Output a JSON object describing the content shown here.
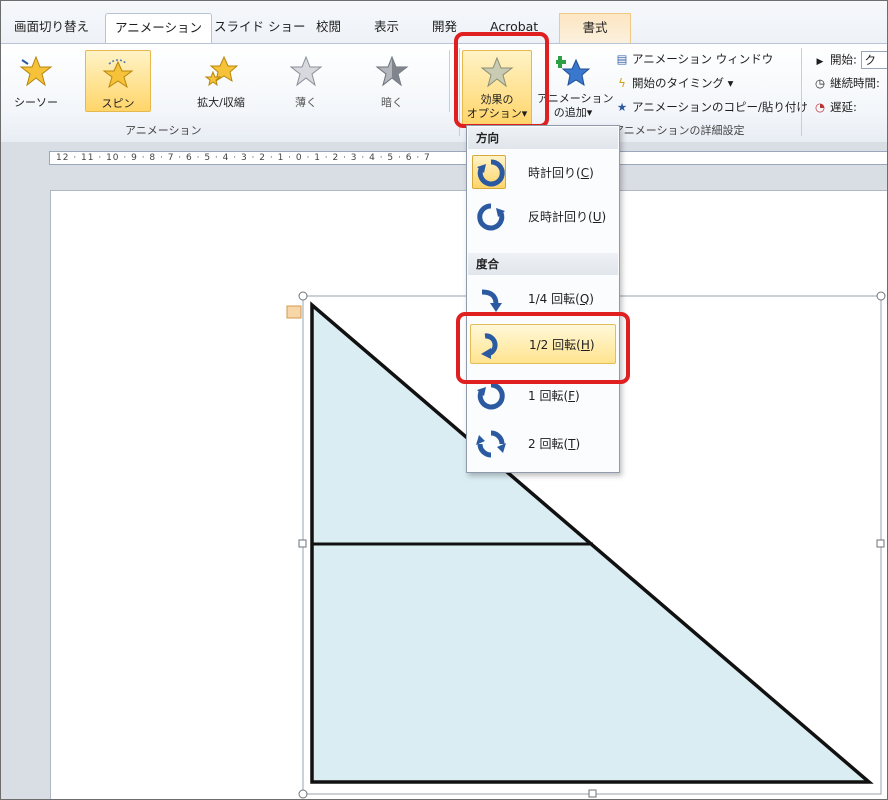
{
  "tabs": [
    {
      "label": "画面切り替え",
      "state": "normal"
    },
    {
      "label": "アニメーション",
      "state": "active"
    },
    {
      "label": "スライド ショー",
      "state": "normal"
    },
    {
      "label": "校閲",
      "state": "normal"
    },
    {
      "label": "表示",
      "state": "normal"
    },
    {
      "label": "開発",
      "state": "normal"
    },
    {
      "label": "Acrobat",
      "state": "normal"
    },
    {
      "label": "書式",
      "state": "contextual"
    }
  ],
  "animation_group": {
    "label": "アニメーション",
    "effects": [
      {
        "label": "シーソー",
        "icon": "seesaw-star-icon",
        "selected": false
      },
      {
        "label": "スピン",
        "icon": "spin-star-icon",
        "selected": true
      },
      {
        "label": "拡大/収縮",
        "icon": "grow-shrink-star-icon",
        "selected": false
      },
      {
        "label": "薄く",
        "icon": "desaturate-star-icon",
        "selected": false
      },
      {
        "label": "暗く",
        "icon": "darken-star-icon",
        "selected": false
      }
    ]
  },
  "effect_options": {
    "line1": "効果の",
    "line2": "オプション",
    "arrow": "▾",
    "icon": "effect-options-star-icon"
  },
  "add_animation": {
    "line1": "アニメーション",
    "line2": "の追加",
    "arrow": "▾",
    "icon": "add-animation-star-icon"
  },
  "advanced_group": {
    "label": "アニメーションの詳細設定",
    "items": [
      {
        "label": "アニメーション ウィンドウ",
        "icon": "animation-pane-icon"
      },
      {
        "label": "開始のタイミング ▾",
        "icon": "trigger-lightning-icon"
      },
      {
        "label": "アニメーションのコピー/貼り付け",
        "icon": "animation-painter-icon"
      }
    ]
  },
  "timing_group": {
    "items": [
      {
        "label": "開始:",
        "value": "ク",
        "icon": "play-triangle-icon"
      },
      {
        "label": "継続時間:",
        "icon": "clock-icon"
      },
      {
        "label": "遅延:",
        "icon": "delay-clock-icon"
      }
    ]
  },
  "ruler": {
    "labels": "12 · 11 · 10 · 9 · 8 · 7 · 6 · 5 · 4 · 3 · 2 · 1 · 0 · 1 · 2 · 3 · 4 · 5 · 6 · 7"
  },
  "dropdown": {
    "sections": [
      {
        "header": "方向",
        "items": [
          {
            "label": "時計回り",
            "key": "C",
            "icon": "clockwise-icon",
            "checked": true
          },
          {
            "label": "反時計回り",
            "key": "U",
            "icon": "counterclockwise-icon",
            "checked": false
          }
        ]
      },
      {
        "header": "度合",
        "items": [
          {
            "label": "1/4 回転",
            "key": "Q",
            "icon": "quarter-turn-icon",
            "hover": false
          },
          {
            "label": "1/2 回転",
            "key": "H",
            "icon": "half-turn-icon",
            "hover": true
          },
          {
            "label": "1 回転",
            "key": "F",
            "icon": "full-turn-icon",
            "hover": false
          },
          {
            "label": "2 回転",
            "key": "T",
            "icon": "two-turns-icon",
            "hover": false
          }
        ]
      }
    ]
  },
  "colors": {
    "highlight": "#e02020",
    "selected_fill": "#ffd56a",
    "shape_fill": "#daedf3",
    "shape_stroke": "#111111",
    "arrow_blue": "#2b5aa0"
  }
}
